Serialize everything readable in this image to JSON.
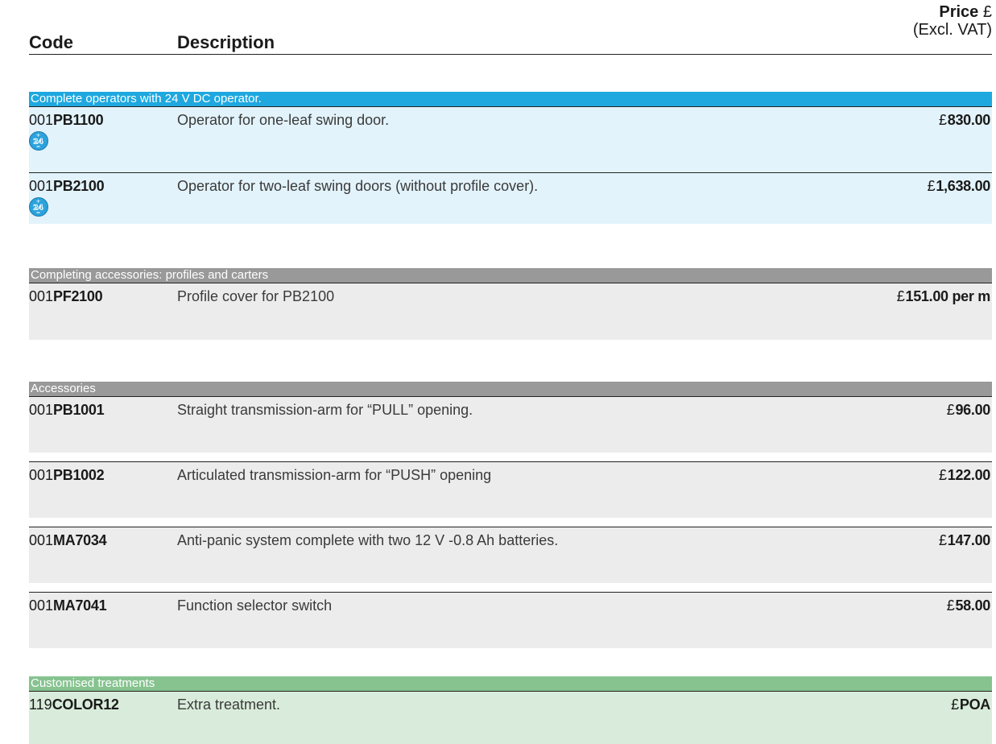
{
  "header": {
    "code_label": "Code",
    "description_label": "Description",
    "price_label": "Price",
    "price_currency": "£",
    "price_note": "(Excl. VAT)"
  },
  "sections": [
    {
      "title": "Complete operators with 24 V DC operator.",
      "color": "#1ea8df",
      "items": [
        {
          "prefix": "001",
          "code": "PB1100",
          "description": "Operator for one-leaf swing door.",
          "currency": "£",
          "price": "830.00",
          "icon": "24v-dc-icon",
          "icon_text": "24"
        },
        {
          "prefix": "001",
          "code": "PB2100",
          "description": "Operator for two-leaf swing doors (without profile cover).",
          "currency": "£",
          "price": "1,638.00",
          "icon": "24v-dc-icon",
          "icon_text": "24"
        }
      ]
    },
    {
      "title": "Completing accessories: profiles and carters",
      "color": "#999999",
      "items": [
        {
          "prefix": "001",
          "code": "PF2100",
          "description": "Profile cover for PB2100",
          "currency": "£",
          "price": "151.00 per m"
        }
      ]
    },
    {
      "title": "Accessories",
      "color": "#999999",
      "items": [
        {
          "prefix": "001",
          "code": "PB1001",
          "description": "Straight transmission-arm for “PULL” opening.",
          "currency": "£",
          "price": "96.00"
        },
        {
          "prefix": "001",
          "code": "PB1002",
          "description": "Articulated transmission-arm for “PUSH” opening",
          "currency": "£",
          "price": "122.00"
        },
        {
          "prefix": "001",
          "code": "MA7034",
          "description": "Anti-panic system complete with two 12 V -0.8 Ah batteries.",
          "currency": "£",
          "price": "147.00"
        },
        {
          "prefix": "001",
          "code": "MA7041",
          "description": "Function selector switch",
          "currency": "£",
          "price": "58.00"
        }
      ]
    },
    {
      "title": "Customised treatments",
      "color": "#86c38f",
      "items": [
        {
          "prefix": "119",
          "code": "COLOR12",
          "description": "Extra treatment.",
          "currency": "£",
          "price": "POA"
        }
      ]
    }
  ]
}
